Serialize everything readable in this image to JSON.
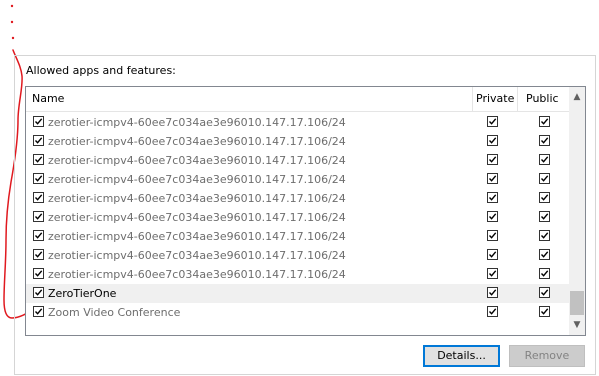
{
  "group_title": "Allowed apps and features:",
  "columns": {
    "name": "Name",
    "private": "Private",
    "public": "Public"
  },
  "rows": [
    {
      "name": "zerotier-icmpv4-60ee7c034ae3e96010.147.17.106/24",
      "checked": true,
      "private": true,
      "public": true,
      "gray": true
    },
    {
      "name": "zerotier-icmpv4-60ee7c034ae3e96010.147.17.106/24",
      "checked": true,
      "private": true,
      "public": true,
      "gray": true
    },
    {
      "name": "zerotier-icmpv4-60ee7c034ae3e96010.147.17.106/24",
      "checked": true,
      "private": true,
      "public": true,
      "gray": true
    },
    {
      "name": "zerotier-icmpv4-60ee7c034ae3e96010.147.17.106/24",
      "checked": true,
      "private": true,
      "public": true,
      "gray": true
    },
    {
      "name": "zerotier-icmpv4-60ee7c034ae3e96010.147.17.106/24",
      "checked": true,
      "private": true,
      "public": true,
      "gray": true
    },
    {
      "name": "zerotier-icmpv4-60ee7c034ae3e96010.147.17.106/24",
      "checked": true,
      "private": true,
      "public": true,
      "gray": true
    },
    {
      "name": "zerotier-icmpv4-60ee7c034ae3e96010.147.17.106/24",
      "checked": true,
      "private": true,
      "public": true,
      "gray": true
    },
    {
      "name": "zerotier-icmpv4-60ee7c034ae3e96010.147.17.106/24",
      "checked": true,
      "private": true,
      "public": true,
      "gray": true
    },
    {
      "name": "zerotier-icmpv4-60ee7c034ae3e96010.147.17.106/24",
      "checked": true,
      "private": true,
      "public": true,
      "gray": true
    },
    {
      "name": "ZeroTierOne",
      "checked": true,
      "private": true,
      "public": true,
      "gray": false,
      "selected": true
    },
    {
      "name": "Zoom Video Conference",
      "checked": true,
      "private": true,
      "public": true,
      "gray": true
    }
  ],
  "buttons": {
    "details": "Details...",
    "remove": "Remove"
  },
  "colors": {
    "annotation": "#e0191f",
    "focus_border": "#0078d7"
  }
}
